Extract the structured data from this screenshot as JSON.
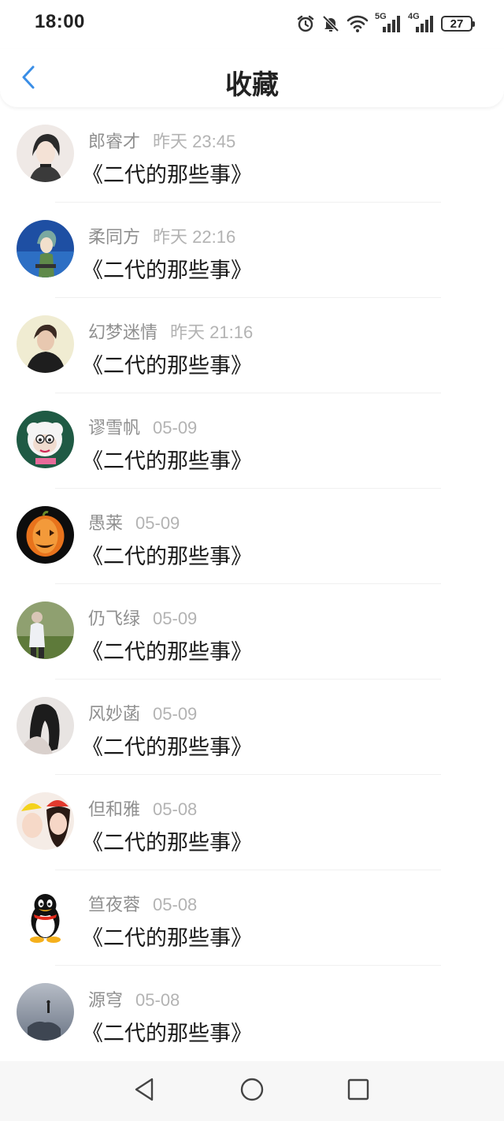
{
  "status_bar": {
    "time": "18:00",
    "battery": "27",
    "network_1": "5G",
    "network_2": "4G",
    "icons": [
      "alarm-icon",
      "mute-icon",
      "wifi-icon",
      "signal-5g-icon",
      "signal-4g-icon",
      "battery-icon"
    ]
  },
  "header": {
    "title": "收藏",
    "back_icon": "chevron-left-icon",
    "accent_color": "#3a8ee6"
  },
  "favorites": [
    {
      "user": "郎睿才",
      "time": "昨天 23:45",
      "title": "《二代的那些事》"
    },
    {
      "user": "柔同方",
      "time": "昨天 22:16",
      "title": "《二代的那些事》"
    },
    {
      "user": "幻梦迷情",
      "time": "昨天 21:16",
      "title": "《二代的那些事》"
    },
    {
      "user": "谬雪帆",
      "time": "05-09",
      "title": "《二代的那些事》"
    },
    {
      "user": "愚莱",
      "time": "05-09",
      "title": "《二代的那些事》"
    },
    {
      "user": "仍飞绿",
      "time": "05-09",
      "title": "《二代的那些事》"
    },
    {
      "user": "风妙菡",
      "time": "05-09",
      "title": "《二代的那些事》"
    },
    {
      "user": "但和雅",
      "time": "05-08",
      "title": "《二代的那些事》"
    },
    {
      "user": "笪夜蓉",
      "time": "05-08",
      "title": "《二代的那些事》"
    },
    {
      "user": "源穹",
      "time": "05-08",
      "title": "《二代的那些事》"
    }
  ],
  "nav_bar": {
    "icons": [
      "back-triangle-icon",
      "home-circle-icon",
      "recents-square-icon"
    ]
  }
}
